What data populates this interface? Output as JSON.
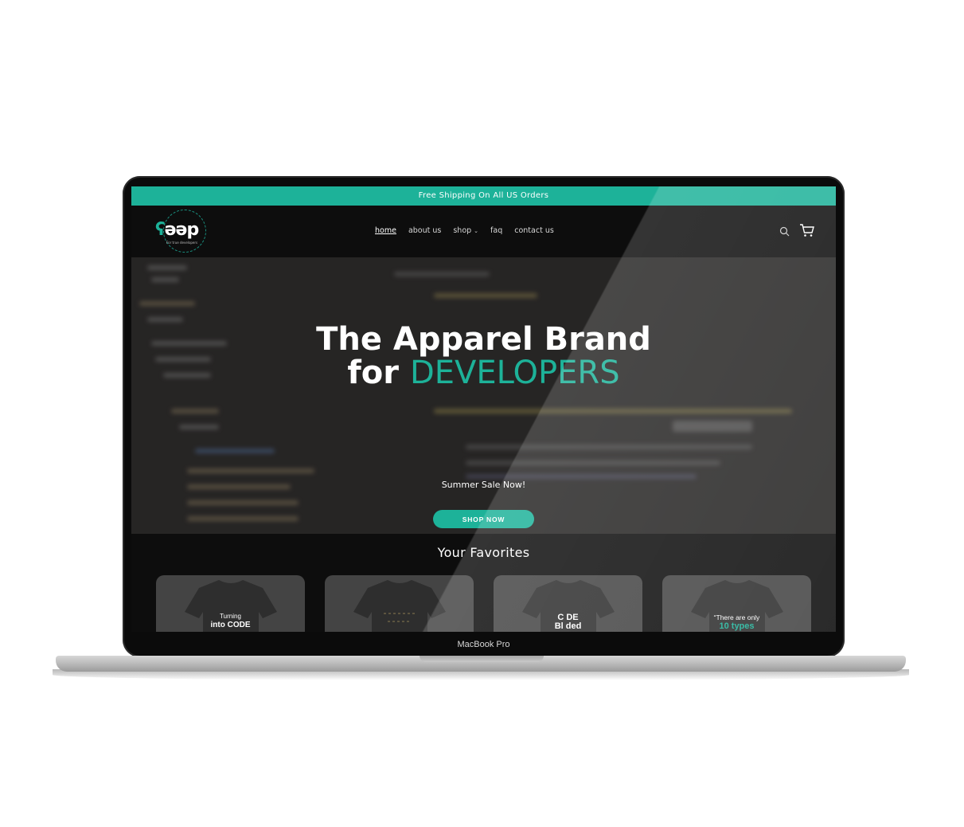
{
  "announcement": "Free Shipping On All US Orders",
  "logo": {
    "prefix": "ʕ",
    "word": "ǝəp",
    "tagline": "For true developers"
  },
  "nav": {
    "items": [
      {
        "label": "home",
        "active": true
      },
      {
        "label": "about us"
      },
      {
        "label": "shop",
        "has_dropdown": true
      },
      {
        "label": "faq"
      },
      {
        "label": "contact us"
      }
    ]
  },
  "header_icons": [
    "search-icon",
    "cart-icon"
  ],
  "hero": {
    "title_line1": "The Apparel Brand",
    "title_line2_prefix": "for ",
    "title_line2_accent": "DEVELOPERS",
    "subtitle": "Summer Sale Now!",
    "cta": "SHOP NOW"
  },
  "favorites": {
    "title": "Your Favorites",
    "products": [
      {
        "line1": "Turning",
        "line2": "into CODE"
      },
      {
        "line1": "",
        "line2": ""
      },
      {
        "line1": "C DE",
        "line2": "Bl  ded"
      },
      {
        "line1": "“There are only",
        "line2": "10 types"
      }
    ]
  },
  "device_label": "MacBook Pro",
  "colors": {
    "accent": "#1db299",
    "background": "#0d0d0d",
    "card": "#444444"
  }
}
